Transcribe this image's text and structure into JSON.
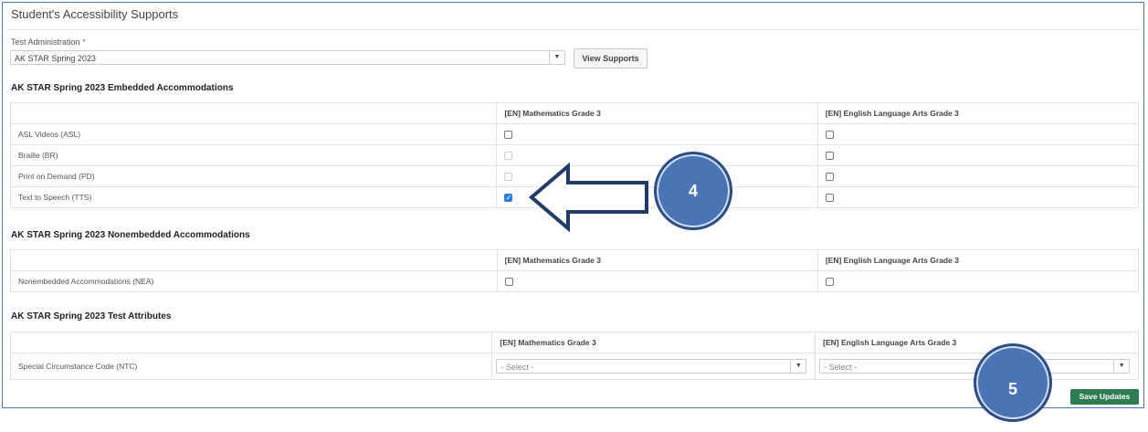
{
  "page": {
    "title": "Student's Accessibility Supports"
  },
  "admin": {
    "label": "Test Administration",
    "required_mark": "*",
    "selected": "AK STAR Spring 2023",
    "view_button": "View Supports"
  },
  "embedded": {
    "title": "AK STAR Spring 2023 Embedded Accommodations",
    "columns": [
      "",
      "[EN] Mathematics Grade 3",
      "[EN] English Language Arts Grade 3"
    ],
    "rows": [
      {
        "label": "ASL Videos (ASL)",
        "math": "unchecked",
        "ela": "unchecked"
      },
      {
        "label": "Braille (BR)",
        "math": "disabled",
        "ela": "unchecked"
      },
      {
        "label": "Print on Demand (PD)",
        "math": "disabled",
        "ela": "unchecked"
      },
      {
        "label": "Text to Speech (TTS)",
        "math": "checked",
        "ela": "unchecked"
      }
    ]
  },
  "nonembedded": {
    "title": "AK STAR Spring 2023 Nonembedded Accommodations",
    "columns": [
      "",
      "[EN] Mathematics Grade 3",
      "[EN] English Language Arts Grade 3"
    ],
    "rows": [
      {
        "label": "Nonembedded Accommodations (NEA)",
        "math": "unchecked",
        "ela": "unchecked"
      }
    ]
  },
  "attributes": {
    "title": "AK STAR Spring 2023 Test Attributes",
    "columns": [
      "",
      "[EN] Mathematics Grade 3",
      "[EN] English Language Arts Grade 3"
    ],
    "rows": [
      {
        "label": "Special Circumstance Code (NTC)",
        "math": "- Select -",
        "ela": "- Select -"
      }
    ]
  },
  "callouts": {
    "step4": "4",
    "step5": "5"
  },
  "save_button": "Save Updates",
  "colors": {
    "accent": "#4a75b5",
    "save": "#2e7d52",
    "frame": "#4a79b8",
    "checked": "#2f7de1"
  }
}
